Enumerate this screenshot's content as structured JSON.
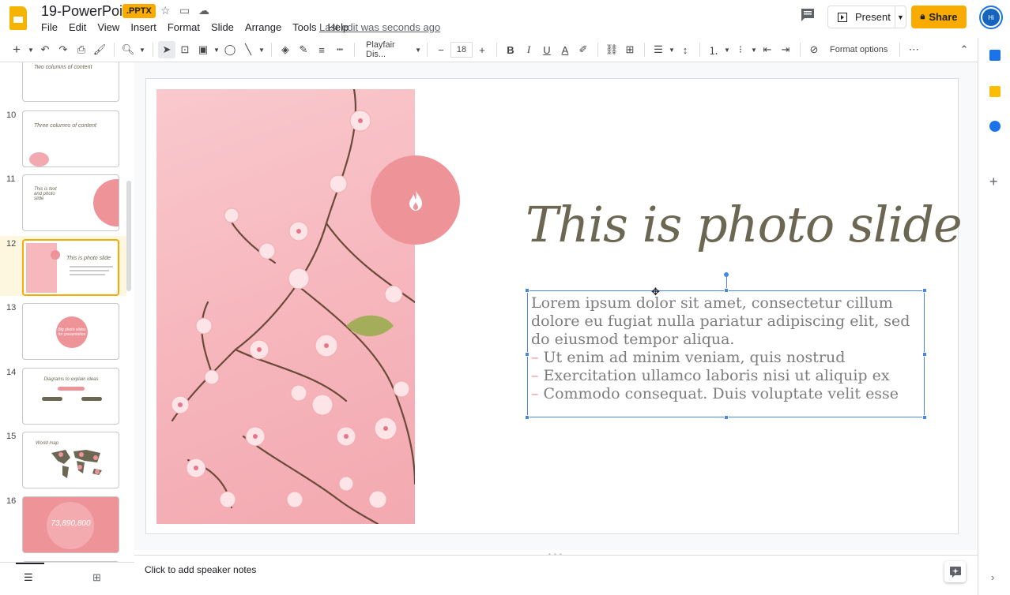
{
  "app": {
    "doc_title": "19-PowerPoint",
    "file_badge": ".PPTX",
    "last_edit": "Last edit was seconds ago",
    "present_label": "Present",
    "share_label": "Share",
    "avatar_initials": "Hi"
  },
  "menu": [
    "File",
    "Edit",
    "View",
    "Insert",
    "Format",
    "Slide",
    "Arrange",
    "Tools",
    "Help"
  ],
  "toolbar": {
    "font_name": "Playfair Dis...",
    "font_size": "18",
    "format_options": "Format options"
  },
  "filmstrip": {
    "slides": [
      {
        "num": "",
        "caption": "Two columns of content"
      },
      {
        "num": "10",
        "caption": "Three columns of content"
      },
      {
        "num": "11",
        "caption": "This is text and photo slide"
      },
      {
        "num": "12",
        "caption": "This is photo slide"
      },
      {
        "num": "13",
        "caption": "Big photo slides for presentation"
      },
      {
        "num": "14",
        "caption": "Diagrams to explain ideas"
      },
      {
        "num": "15",
        "caption": "World map"
      },
      {
        "num": "16",
        "caption": "73,890,800"
      }
    ]
  },
  "slide": {
    "title": "This is photo slide",
    "paragraph": "Lorem ipsum dolor sit amet, consectetur cillum dolore eu fugiat nulla pariatur adipiscing elit, sed do eiusmod tempor aliqua.",
    "bullets": [
      "Ut enim ad minim veniam, quis nostrud",
      "Exercitation ullamco laboris nisi ut aliquip ex",
      "Commodo consequat. Duis voluptate velit esse"
    ],
    "bullet_marker": "–"
  },
  "notes": {
    "placeholder": "Click to add speaker notes"
  },
  "colors": {
    "accent": "#f9ab00",
    "selection": "#4a86e8",
    "slide_pink": "#ee9398",
    "title_color": "#6b6753"
  }
}
